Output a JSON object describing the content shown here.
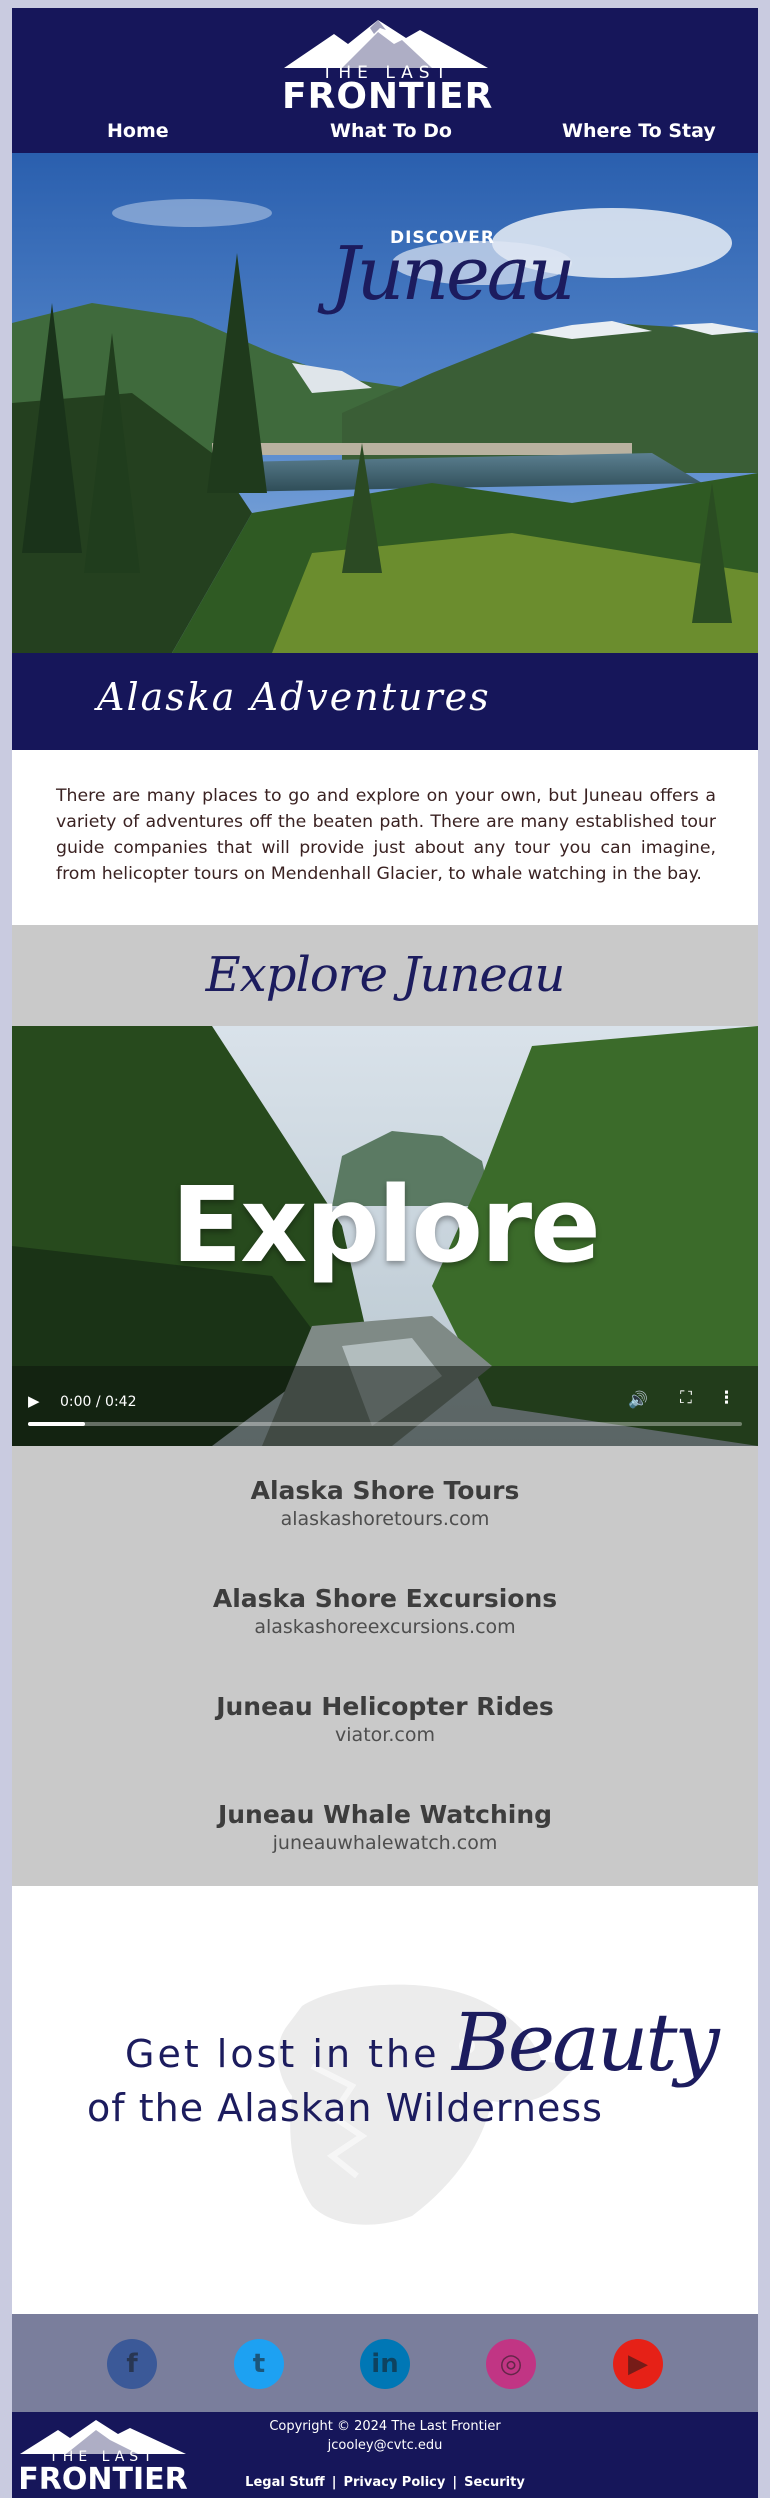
{
  "header": {
    "logo_top": "THE LAST",
    "logo_main": "FRONTIER",
    "nav": [
      {
        "label": "Home"
      },
      {
        "label": "What To Do"
      },
      {
        "label": "Where To Stay"
      }
    ]
  },
  "hero": {
    "kicker": "DISCOVER",
    "title": "Juneau"
  },
  "adventures": {
    "title": "Alaska Adventures",
    "intro": "There are many places to go and explore on your own, but Juneau offers a variety of adventures off the beaten path. There are many established tour guide companies that will provide just about any tour you can imagine, from helicopter tours on Mendenhall Glacier, to whale watching in the bay."
  },
  "explore": {
    "title": "Explore Juneau",
    "video": {
      "overlay_word": "Explore",
      "time": "0:00 / 0:42",
      "progress_fraction": 0.08
    }
  },
  "tours": [
    {
      "name": "Alaska Shore Tours",
      "link": "alaskashoretours.com"
    },
    {
      "name": "Alaska Shore Excursions",
      "link": "alaskashoreexcursions.com"
    },
    {
      "name": "Juneau Helicopter Rides",
      "link": "viator.com"
    },
    {
      "name": "Juneau Whale Watching",
      "link": "juneauwhalewatch.com"
    }
  ],
  "beauty": {
    "line1": "Get lost in the",
    "accent": "Beauty",
    "line2": "of the Alaskan Wilderness"
  },
  "social": [
    {
      "name": "facebook",
      "glyph": "f",
      "color": "#3b5998"
    },
    {
      "name": "twitter",
      "glyph": "t",
      "color": "#1da1f2"
    },
    {
      "name": "linkedin",
      "glyph": "in",
      "color": "#0077b5"
    },
    {
      "name": "instagram",
      "glyph": "◎",
      "color": "#c13584"
    },
    {
      "name": "youtube",
      "glyph": "▶",
      "color": "#e62117"
    }
  ],
  "footer": {
    "logo_top": "THE LAST",
    "logo_main": "FRONTIER",
    "copyright": "Copyright © 2024 The Last Frontier",
    "email": "jcooley@cvtc.edu",
    "links": [
      "Legal Stuff",
      "Privacy Policy",
      "Security"
    ]
  }
}
